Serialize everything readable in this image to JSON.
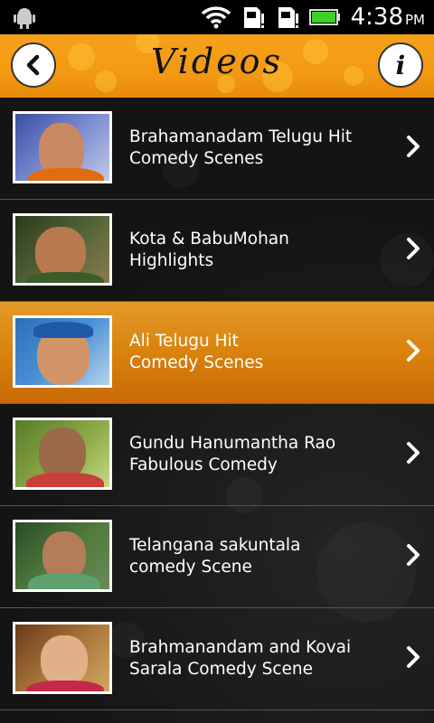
{
  "status_bar": {
    "time": "4:38",
    "ampm": "PM"
  },
  "header": {
    "title": "Videos",
    "info_label": "i"
  },
  "videos": [
    {
      "title": "Brahamanadam Telugu Hit\nComedy Scenes"
    },
    {
      "title": "Kota & BabuMohan\nHighlights"
    },
    {
      "title": "Ali Telugu Hit\nComedy Scenes"
    },
    {
      "title": "Gundu Hanumantha Rao\nFabulous Comedy"
    },
    {
      "title": "Telangana sakuntala\ncomedy Scene"
    },
    {
      "title": "Brahmanandam and Kovai\nSarala Comedy Scene"
    }
  ],
  "colors": {
    "header_orange": "#f39a12",
    "active_row": "#d9820d",
    "list_bg": "#141414"
  }
}
